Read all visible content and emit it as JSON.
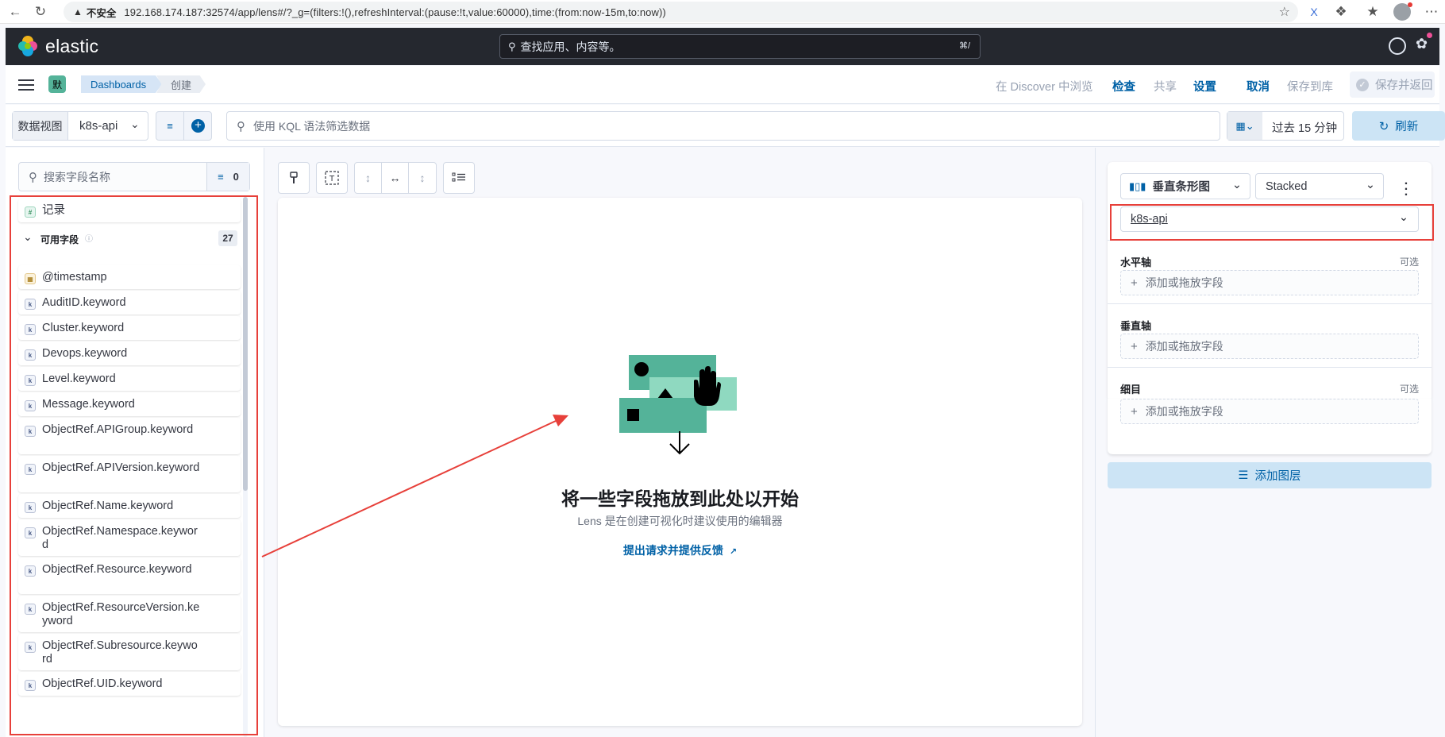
{
  "browser": {
    "security_warning": "不安全",
    "url": "192.168.174.187:32574/app/lens#/?_g=(filters:!(),refreshInterval:(pause:!t,value:60000),time:(from:now-15m,to:now))"
  },
  "header": {
    "brand": "elastic",
    "search_placeholder": "查找应用、内容等。",
    "search_shortcut": "⌘/"
  },
  "toolbar": {
    "space_badge": "默",
    "breadcrumbs": [
      "Dashboards",
      "创建"
    ],
    "links": {
      "discover": "在 Discover 中浏览",
      "inspect": "检查",
      "share": "共享",
      "settings": "设置",
      "cancel": "取消",
      "save_to_library": "保存到库",
      "save_and_return": "保存并返回"
    }
  },
  "query": {
    "dataview_label": "数据视图",
    "dataview_value": "k8s-api",
    "kql_placeholder": "使用 KQL 语法筛选数据",
    "time_range": "过去 15 分钟",
    "refresh_label": "刷新"
  },
  "left": {
    "search_placeholder": "搜索字段名称",
    "filter_count": "0",
    "records_label": "记录",
    "available_fields_title": "可用字段",
    "available_fields_count": "27",
    "fields": [
      {
        "type": "date",
        "name": "@timestamp"
      },
      {
        "type": "k",
        "name": "AuditID.keyword"
      },
      {
        "type": "k",
        "name": "Cluster.keyword"
      },
      {
        "type": "k",
        "name": "Devops.keyword"
      },
      {
        "type": "k",
        "name": "Level.keyword"
      },
      {
        "type": "k",
        "name": "Message.keyword"
      },
      {
        "type": "k",
        "name": "ObjectRef.APIGroup.keyword"
      },
      {
        "type": "k",
        "name": "ObjectRef.APIVersion.keyword"
      },
      {
        "type": "k",
        "name": "ObjectRef.Name.keyword"
      },
      {
        "type": "k",
        "name": "ObjectRef.Namespace.keyword"
      },
      {
        "type": "k",
        "name": "ObjectRef.Resource.keyword"
      },
      {
        "type": "k",
        "name": "ObjectRef.ResourceVersion.keyword"
      },
      {
        "type": "k",
        "name": "ObjectRef.Subresource.keyword"
      },
      {
        "type": "k",
        "name": "ObjectRef.UID.keyword"
      }
    ]
  },
  "center": {
    "empty_title": "将一些字段拖放到此处以开始",
    "empty_subtitle": "Lens 是在创建可视化时建议使用的编辑器",
    "feedback_link": "提出请求并提供反馈"
  },
  "right": {
    "chart_type": "垂直条形图",
    "stack_mode": "Stacked",
    "dataview": "k8s-api",
    "horizontal_axis": "水平轴",
    "vertical_axis": "垂直轴",
    "breakdown": "细目",
    "optional": "可选",
    "drop_placeholder": "添加或拖放字段",
    "add_layer": "添加图层"
  },
  "annotation_color": "#e7403a"
}
